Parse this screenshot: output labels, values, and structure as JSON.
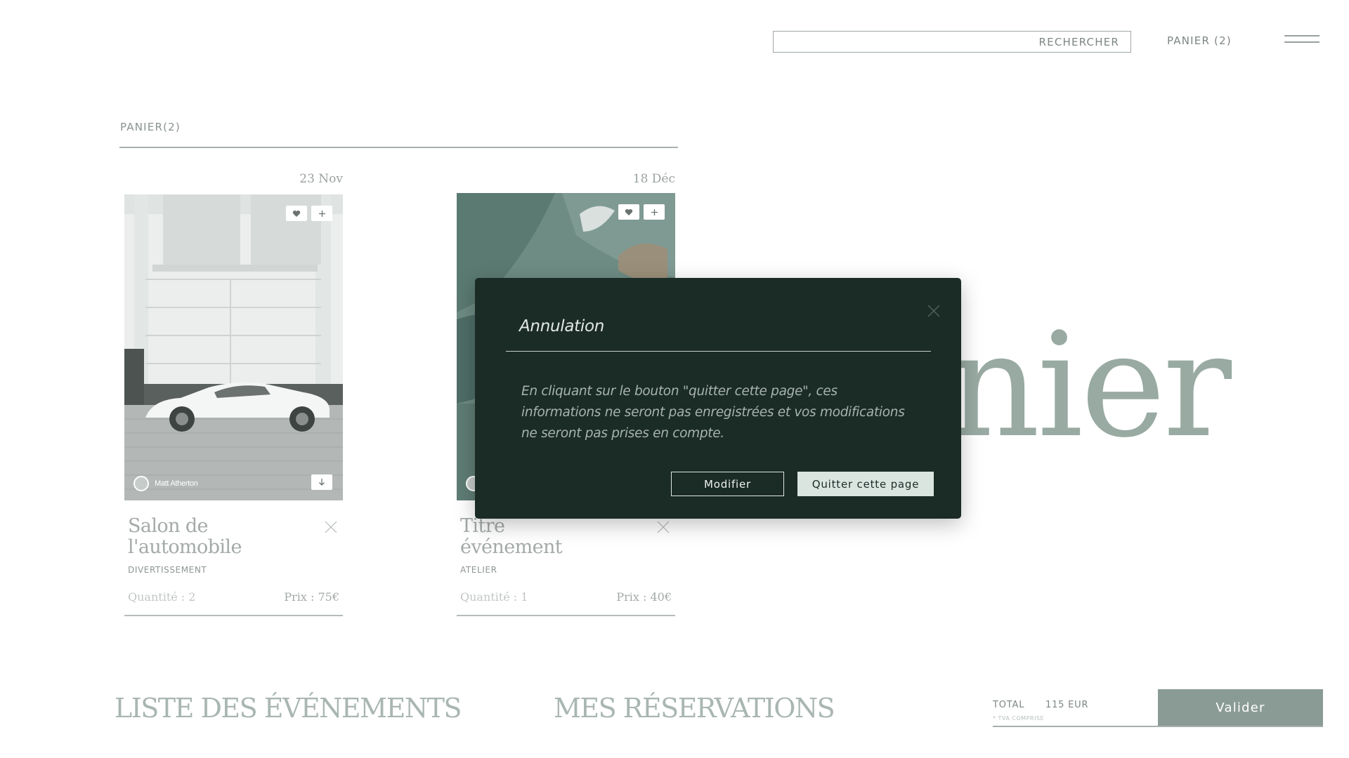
{
  "header": {
    "search_label": "RECHERCHER",
    "search_placeholder": "",
    "cart_label": "PANIER (2)",
    "menu_icon": "hamburger-icon"
  },
  "cart": {
    "section_title": "PANIER(2)",
    "big_word": "anier",
    "items": [
      {
        "date": "23 Nov",
        "title_line1": "Salon de",
        "title_line2": "l'automobile",
        "category": "DIVERTISSEMENT",
        "quantity": "Quantité : 2",
        "price": "Prix : 75€",
        "photo_credit": "Matt Atherton",
        "image": "white-sports-car-photo"
      },
      {
        "date": "18 Déc",
        "title_line1": "Titre",
        "title_line2": "événement",
        "category": "ATELIER",
        "quantity": "Quantité : 1",
        "price": "Prix : 40€",
        "image": "tropical-plant-photo"
      }
    ]
  },
  "footer": {
    "nav_events": "LISTE DES ÉVÉNEMENTS",
    "nav_bookings": "MES RÉSERVATIONS",
    "total_label": "TOTAL",
    "total_value": "115 EUR",
    "total_note": "* TVA COMPRISE",
    "validate_label": "Valider"
  },
  "modal": {
    "title": "Annulation",
    "message": "En cliquant sur le bouton \"quitter cette page\", ces informations ne seront pas enregistrées et vos modifications ne seront pas prises en compte.",
    "modify_label": "Modifier",
    "quit_label": "Quitter cette page"
  },
  "colors": {
    "modal_bg": "#1b2b26",
    "accent": "#8a9b95",
    "quit_button": "#dae5e0"
  }
}
